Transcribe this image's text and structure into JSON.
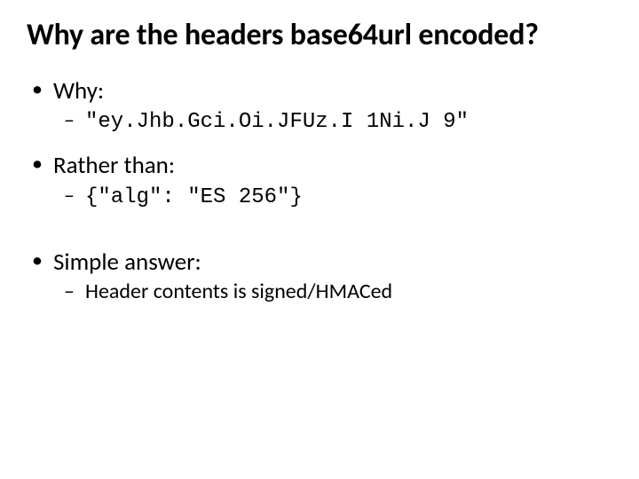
{
  "title": "Why are the headers base64url encoded?",
  "bullets": {
    "why_label": "Why:",
    "why_value": "\"ey.Jhb.Gci.Oi.JFUz.I 1Ni.J 9\"",
    "rather_label": "Rather than:",
    "rather_value": "{\"alg\": \"ES 256\"}",
    "answer_label": "Simple answer:",
    "answer_value": "Header contents is signed/HMACed"
  }
}
